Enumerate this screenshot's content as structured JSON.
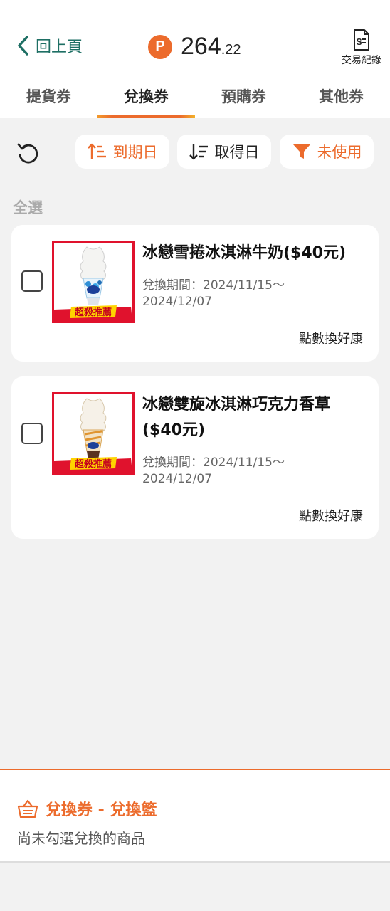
{
  "header": {
    "back_label": "回上頁",
    "points_badge": "P",
    "points_integer": "264",
    "points_decimal": ".22",
    "transactions_label": "交易紀錄"
  },
  "tabs": [
    {
      "label": "提貨券",
      "active": false
    },
    {
      "label": "兌換券",
      "active": true
    },
    {
      "label": "預購券",
      "active": false
    },
    {
      "label": "其他券",
      "active": false
    }
  ],
  "toolbar": {
    "sort_expire_label": "到期日",
    "sort_obtain_label": "取得日",
    "filter_label": "未使用"
  },
  "list": {
    "select_all_label": "全選",
    "items": [
      {
        "name": "冰戀雪捲冰淇淋牛奶($40元)",
        "period_line1": "兌換期間：2024/11/15～",
        "period_line2": "2024/12/07",
        "action_label": "點數換好康",
        "badge": "超殺推薦",
        "checked": false
      },
      {
        "name": "冰戀雙旋冰淇淋巧克力香草($40元)",
        "period_line1": "兌換期間：2024/11/15～",
        "period_line2": "2024/12/07",
        "action_label": "點數換好康",
        "badge": "超殺推薦",
        "checked": false
      }
    ]
  },
  "basket": {
    "title": "兌換券 - 兌換籃",
    "empty_text": "尚未勾選兌換的商品"
  },
  "colors": {
    "accent": "#ec6b2c",
    "back_link": "#1e6f64",
    "badge_red": "#e0122d",
    "background": "#f2f2f2"
  }
}
